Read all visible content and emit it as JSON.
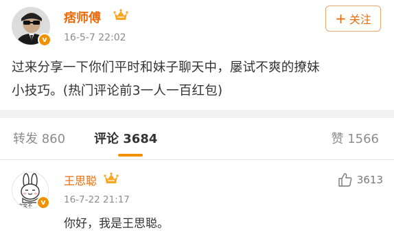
{
  "post": {
    "author_name": "痞师傅",
    "verified_badge": "v",
    "time": "16-5-7 22:02",
    "follow_label": "关注",
    "follow_icon": "plus-icon",
    "content_line1": "过来分享一下你们平时和妹子聊天中，屡试不爽的撩妹",
    "content_line2": "小技巧。(热门评论前3一人一百红包)"
  },
  "tabs": {
    "repost": "转发 860",
    "comment": "评论 3684",
    "like": "赞 1566"
  },
  "comment": {
    "author_name": "王思聪",
    "verified_badge": "v",
    "avatar_caption": "宝宝不",
    "time": "16-7-22 21:17",
    "like_count": "3613",
    "text": "你好，我是王思聪。"
  },
  "colors": {
    "brand_orange": "#e86b0c",
    "badge_orange": "#f29100",
    "divider_gray": "#f2f2f2"
  }
}
